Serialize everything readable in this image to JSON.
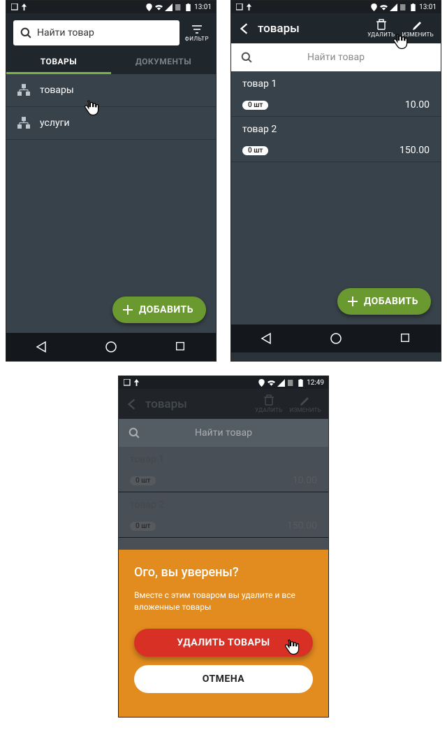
{
  "status_time_a": "13:01",
  "status_time_b": "12:49",
  "screen1": {
    "search_placeholder": "Найти товар",
    "filter_label": "ФИЛЬТР",
    "tabs": {
      "left": "ТОВАРЫ",
      "right": "ДОКУМЕНТЫ"
    },
    "cats": [
      "товары",
      "услуги"
    ],
    "fab": "ДОБАВИТЬ"
  },
  "screen2": {
    "title": "товары",
    "action_delete": "УДАЛИТЬ",
    "action_edit": "ИЗМЕНИТЬ",
    "search_placeholder": "Найти товар",
    "items": [
      {
        "name": "товар 1",
        "qty": "0 шт",
        "price": "10.00"
      },
      {
        "name": "товар 2",
        "qty": "0 шт",
        "price": "150.00"
      }
    ],
    "fab": "ДОБАВИТЬ"
  },
  "screen3": {
    "title": "товары",
    "action_delete": "УДАЛИТЬ",
    "action_edit": "ИЗМЕНИТЬ",
    "search_placeholder": "Найти товар",
    "items": [
      {
        "name": "товар 1",
        "qty": "0 шт",
        "price": "10.00"
      },
      {
        "name": "товар 2",
        "qty": "0 шт",
        "price": "150.00"
      }
    ],
    "dialog": {
      "heading": "Ого, вы уверены?",
      "body": "Вместе с этим товаром вы удалите и все вложенные товары",
      "confirm": "УДАЛИТЬ ТОВАРЫ",
      "cancel": "ОТМЕНА"
    }
  }
}
